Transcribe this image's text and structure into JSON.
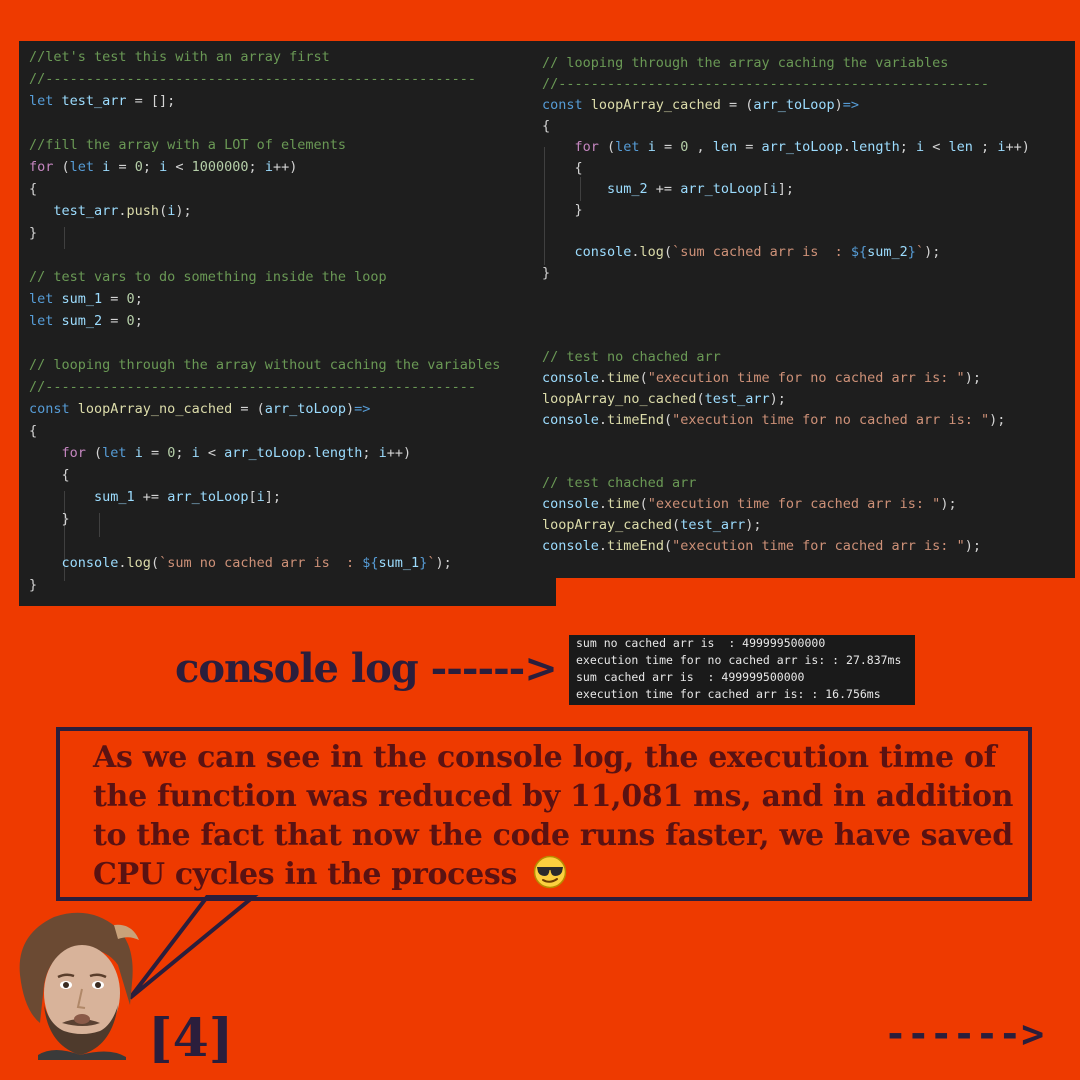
{
  "code_left": [
    {
      "t": "//let's test this with an array first",
      "k": "cm"
    },
    {
      "t": "//-----------------------------------------------------",
      "k": "cm"
    },
    [
      {
        "t": "let ",
        "k": "kw"
      },
      {
        "t": "test_arr",
        "k": "vr"
      },
      {
        "t": " = [];",
        "k": ""
      }
    ],
    [],
    {
      "t": "//fill the array with a LOT of elements",
      "k": "cm"
    },
    [
      {
        "t": "for",
        "k": "kc"
      },
      {
        "t": " (",
        "k": ""
      },
      {
        "t": "let ",
        "k": "kw"
      },
      {
        "t": "i",
        "k": "vr"
      },
      {
        "t": " = ",
        "k": ""
      },
      {
        "t": "0",
        "k": "nm"
      },
      {
        "t": "; ",
        "k": ""
      },
      {
        "t": "i",
        "k": "vr"
      },
      {
        "t": " < ",
        "k": ""
      },
      {
        "t": "1000000",
        "k": "nm"
      },
      {
        "t": "; ",
        "k": ""
      },
      {
        "t": "i",
        "k": "vr"
      },
      {
        "t": "++)",
        "k": ""
      }
    ],
    [
      {
        "t": "{",
        "k": ""
      }
    ],
    [
      {
        "t": "   test_arr",
        "k": "vr"
      },
      {
        "t": ".",
        "k": ""
      },
      {
        "t": "push",
        "k": "fn"
      },
      {
        "t": "(",
        "k": ""
      },
      {
        "t": "i",
        "k": "vr"
      },
      {
        "t": ");",
        "k": ""
      }
    ],
    [
      {
        "t": "}",
        "k": ""
      }
    ],
    [],
    {
      "t": "// test vars to do something inside the loop",
      "k": "cm"
    },
    [
      {
        "t": "let ",
        "k": "kw"
      },
      {
        "t": "sum_1",
        "k": "vr"
      },
      {
        "t": " = ",
        "k": ""
      },
      {
        "t": "0",
        "k": "nm"
      },
      {
        "t": ";",
        "k": ""
      }
    ],
    [
      {
        "t": "let ",
        "k": "kw"
      },
      {
        "t": "sum_2",
        "k": "vr"
      },
      {
        "t": " = ",
        "k": ""
      },
      {
        "t": "0",
        "k": "nm"
      },
      {
        "t": ";",
        "k": ""
      }
    ],
    [],
    {
      "t": "// looping through the array without caching the variables",
      "k": "cm"
    },
    {
      "t": "//-----------------------------------------------------",
      "k": "cm"
    },
    [
      {
        "t": "const ",
        "k": "kw"
      },
      {
        "t": "loopArray_no_cached",
        "k": "fn"
      },
      {
        "t": " = (",
        "k": ""
      },
      {
        "t": "arr_toLoop",
        "k": "vr"
      },
      {
        "t": ")",
        "k": ""
      },
      {
        "t": "=>",
        "k": "kw"
      }
    ],
    [
      {
        "t": "{",
        "k": ""
      }
    ],
    [
      {
        "t": "    for",
        "k": "kc"
      },
      {
        "t": " (",
        "k": ""
      },
      {
        "t": "let ",
        "k": "kw"
      },
      {
        "t": "i",
        "k": "vr"
      },
      {
        "t": " = ",
        "k": ""
      },
      {
        "t": "0",
        "k": "nm"
      },
      {
        "t": "; ",
        "k": ""
      },
      {
        "t": "i",
        "k": "vr"
      },
      {
        "t": " < ",
        "k": ""
      },
      {
        "t": "arr_toLoop",
        "k": "vr"
      },
      {
        "t": ".",
        "k": ""
      },
      {
        "t": "length",
        "k": "vr"
      },
      {
        "t": "; ",
        "k": ""
      },
      {
        "t": "i",
        "k": "vr"
      },
      {
        "t": "++)",
        "k": ""
      }
    ],
    [
      {
        "t": "    {",
        "k": ""
      }
    ],
    [
      {
        "t": "        sum_1",
        "k": "vr"
      },
      {
        "t": " += ",
        "k": ""
      },
      {
        "t": "arr_toLoop",
        "k": "vr"
      },
      {
        "t": "[",
        "k": ""
      },
      {
        "t": "i",
        "k": "vr"
      },
      {
        "t": "];",
        "k": ""
      }
    ],
    [
      {
        "t": "    }",
        "k": ""
      }
    ],
    [],
    [
      {
        "t": "    console",
        "k": "vr"
      },
      {
        "t": ".",
        "k": ""
      },
      {
        "t": "log",
        "k": "fn"
      },
      {
        "t": "(",
        "k": ""
      },
      {
        "t": "`sum no cached arr is  : ",
        "k": "st"
      },
      {
        "t": "${",
        "k": "kw"
      },
      {
        "t": "sum_1",
        "k": "vr"
      },
      {
        "t": "}",
        "k": "kw"
      },
      {
        "t": "`",
        "k": "st"
      },
      {
        "t": ");",
        "k": ""
      }
    ],
    [
      {
        "t": "}",
        "k": ""
      }
    ]
  ],
  "code_right": [
    {
      "t": "// looping through the array caching the variables",
      "k": "cm"
    },
    {
      "t": "//-----------------------------------------------------",
      "k": "cm"
    },
    [
      {
        "t": "const ",
        "k": "kw"
      },
      {
        "t": "loopArray_cached",
        "k": "fn"
      },
      {
        "t": " = (",
        "k": ""
      },
      {
        "t": "arr_toLoop",
        "k": "vr"
      },
      {
        "t": ")",
        "k": ""
      },
      {
        "t": "=>",
        "k": "kw"
      }
    ],
    [
      {
        "t": "{",
        "k": ""
      }
    ],
    [
      {
        "t": "    for",
        "k": "kc"
      },
      {
        "t": " (",
        "k": ""
      },
      {
        "t": "let ",
        "k": "kw"
      },
      {
        "t": "i",
        "k": "vr"
      },
      {
        "t": " = ",
        "k": ""
      },
      {
        "t": "0",
        "k": "nm"
      },
      {
        "t": " , ",
        "k": ""
      },
      {
        "t": "len",
        "k": "vr"
      },
      {
        "t": " = ",
        "k": ""
      },
      {
        "t": "arr_toLoop",
        "k": "vr"
      },
      {
        "t": ".",
        "k": ""
      },
      {
        "t": "length",
        "k": "vr"
      },
      {
        "t": "; ",
        "k": ""
      },
      {
        "t": "i",
        "k": "vr"
      },
      {
        "t": " < ",
        "k": ""
      },
      {
        "t": "len",
        "k": "vr"
      },
      {
        "t": " ; ",
        "k": ""
      },
      {
        "t": "i",
        "k": "vr"
      },
      {
        "t": "++)",
        "k": ""
      }
    ],
    [
      {
        "t": "    {",
        "k": ""
      }
    ],
    [
      {
        "t": "        sum_2",
        "k": "vr"
      },
      {
        "t": " += ",
        "k": ""
      },
      {
        "t": "arr_toLoop",
        "k": "vr"
      },
      {
        "t": "[",
        "k": ""
      },
      {
        "t": "i",
        "k": "vr"
      },
      {
        "t": "];",
        "k": ""
      }
    ],
    [
      {
        "t": "    }",
        "k": ""
      }
    ],
    [],
    [
      {
        "t": "    console",
        "k": "vr"
      },
      {
        "t": ".",
        "k": ""
      },
      {
        "t": "log",
        "k": "fn"
      },
      {
        "t": "(",
        "k": ""
      },
      {
        "t": "`sum cached arr is  : ",
        "k": "st"
      },
      {
        "t": "${",
        "k": "kw"
      },
      {
        "t": "sum_2",
        "k": "vr"
      },
      {
        "t": "}",
        "k": "kw"
      },
      {
        "t": "`",
        "k": "st"
      },
      {
        "t": ");",
        "k": ""
      }
    ],
    [
      {
        "t": "}",
        "k": ""
      }
    ]
  ],
  "code_tests": [
    {
      "t": "// test no chached arr",
      "k": "cm"
    },
    [
      {
        "t": "console",
        "k": "vr"
      },
      {
        "t": ".",
        "k": ""
      },
      {
        "t": "time",
        "k": "fn"
      },
      {
        "t": "(",
        "k": ""
      },
      {
        "t": "\"execution time for no cached arr is: \"",
        "k": "st"
      },
      {
        "t": ");",
        "k": ""
      }
    ],
    [
      {
        "t": "loopArray_no_cached",
        "k": "fn"
      },
      {
        "t": "(",
        "k": ""
      },
      {
        "t": "test_arr",
        "k": "vr"
      },
      {
        "t": ");",
        "k": ""
      }
    ],
    [
      {
        "t": "console",
        "k": "vr"
      },
      {
        "t": ".",
        "k": ""
      },
      {
        "t": "timeEnd",
        "k": "fn"
      },
      {
        "t": "(",
        "k": ""
      },
      {
        "t": "\"execution time for no cached arr is: \"",
        "k": "st"
      },
      {
        "t": ");",
        "k": ""
      }
    ],
    [],
    [],
    {
      "t": "// test chached arr",
      "k": "cm"
    },
    [
      {
        "t": "console",
        "k": "vr"
      },
      {
        "t": ".",
        "k": ""
      },
      {
        "t": "time",
        "k": "fn"
      },
      {
        "t": "(",
        "k": ""
      },
      {
        "t": "\"execution time for cached arr is: \"",
        "k": "st"
      },
      {
        "t": ");",
        "k": ""
      }
    ],
    [
      {
        "t": "loopArray_cached",
        "k": "fn"
      },
      {
        "t": "(",
        "k": ""
      },
      {
        "t": "test_arr",
        "k": "vr"
      },
      {
        "t": ");",
        "k": ""
      }
    ],
    [
      {
        "t": "console",
        "k": "vr"
      },
      {
        "t": ".",
        "k": ""
      },
      {
        "t": "timeEnd",
        "k": "fn"
      },
      {
        "t": "(",
        "k": ""
      },
      {
        "t": "\"execution time for cached arr is: \"",
        "k": "st"
      },
      {
        "t": ");",
        "k": ""
      }
    ]
  ],
  "console_output": [
    "sum no cached arr is  : 499999500000",
    "execution time for no cached arr is: : 27.837ms",
    "sum cached arr is  : 499999500000",
    "execution time for cached arr is: : 16.756ms"
  ],
  "console_label": "console log ------>",
  "bubble_lines": [
    "As we can see in the console log, the execution time of",
    "the function was reduced by 11,081 ms, and in addition",
    "to the fact that now the code runs faster, we have saved",
    "CPU cycles in the process"
  ],
  "emoji": "smiling-face-with-sunglasses",
  "page_number": "[4]",
  "next_arrow": "------>",
  "colors": {
    "background": "#ee3a00",
    "editor": "#1e1e1e",
    "comment": "#6a9955",
    "keyword": "#569cd6",
    "control": "#c586c0",
    "variable": "#9cdcfe",
    "function": "#dcdcaa",
    "number": "#b5cea8",
    "string": "#ce9178",
    "heading_text": "#2b1e3c",
    "bubble_text": "#5a1212"
  }
}
